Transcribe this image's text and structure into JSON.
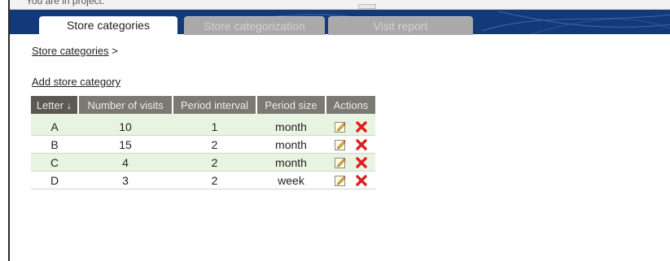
{
  "header": {
    "clipped_text": "You are in project:"
  },
  "tabs": [
    {
      "label": "Store categories",
      "state": "active"
    },
    {
      "label": "Store categorization",
      "state": "inactive"
    },
    {
      "label": "Visit report",
      "state": "inactive"
    }
  ],
  "breadcrumb": {
    "link": "Store categories",
    "separator": ">"
  },
  "add_link": "Add store category",
  "table": {
    "columns": [
      "Letter ↓",
      "Number of visits",
      "Period interval",
      "Period size",
      "Actions"
    ],
    "rows": [
      {
        "letter": "A",
        "visits": "10",
        "interval": "1",
        "size": "month"
      },
      {
        "letter": "B",
        "visits": "15",
        "interval": "2",
        "size": "month"
      },
      {
        "letter": "C",
        "visits": "4",
        "interval": "2",
        "size": "month"
      },
      {
        "letter": "D",
        "visits": "3",
        "interval": "2",
        "size": "week"
      }
    ],
    "row_icons": [
      "edit-icon",
      "delete-icon"
    ]
  },
  "colors": {
    "nav_band": "#123a7a",
    "header_bg": "#7a7a72",
    "row_alt_bg": "#e9f3e2",
    "delete_red": "#e01e1e"
  }
}
